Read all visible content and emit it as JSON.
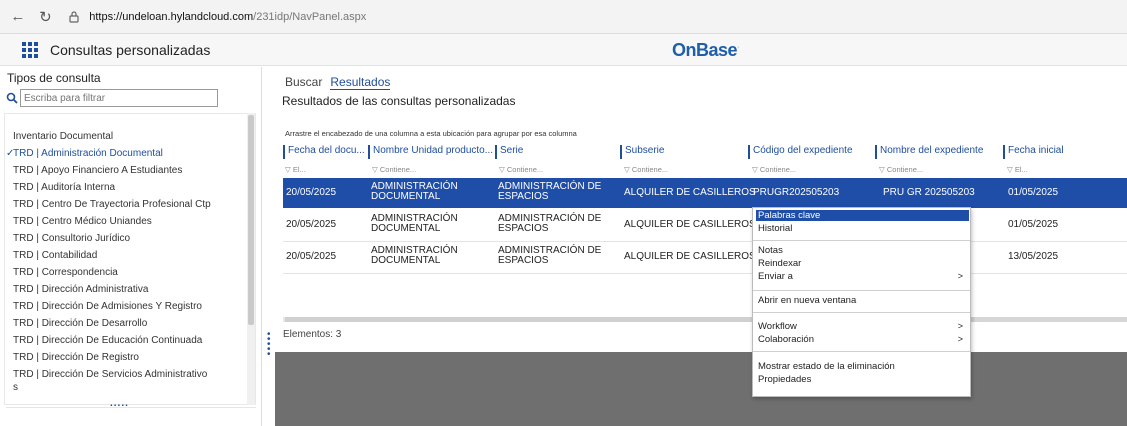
{
  "browser": {
    "url_domain": "https://undeloan.hylandcloud.com",
    "url_path": "/231idp/NavPanel.aspx"
  },
  "app": {
    "title": "Consultas personalizadas",
    "logo": "OnBase",
    "logo_mark": "·"
  },
  "left_panel": {
    "header": "Tipos de consulta",
    "filter_placeholder": "Escriba para filtrar",
    "items": [
      {
        "label": "Inventario Documental",
        "selected": false
      },
      {
        "label": "TRD | Administración Documental",
        "selected": true
      },
      {
        "label": "TRD | Apoyo Financiero A Estudiantes",
        "selected": false
      },
      {
        "label": "TRD | Auditoría Interna",
        "selected": false
      },
      {
        "label": "TRD | Centro De Trayectoria Profesional Ctp",
        "selected": false
      },
      {
        "label": "TRD | Centro Médico Uniandes",
        "selected": false
      },
      {
        "label": "TRD | Consultorio Jurídico",
        "selected": false
      },
      {
        "label": "TRD | Contabilidad",
        "selected": false
      },
      {
        "label": "TRD | Correspondencia",
        "selected": false
      },
      {
        "label": "TRD | Dirección Administrativa",
        "selected": false
      },
      {
        "label": "TRD | Dirección De Admisiones Y Registro",
        "selected": false
      },
      {
        "label": "TRD | Dirección De Desarrollo",
        "selected": false
      },
      {
        "label": "TRD | Dirección De Educación Continuada",
        "selected": false
      },
      {
        "label": "TRD | Dirección De Registro",
        "selected": false
      },
      {
        "label": "TRD | Dirección De Servicios Administrativo",
        "selected": false
      },
      {
        "label": "s",
        "selected": false
      }
    ],
    "more_dots": "....."
  },
  "main": {
    "tabs": [
      {
        "label": "Buscar",
        "active": false
      },
      {
        "label": "Resultados",
        "active": true
      }
    ],
    "results_title": "Resultados de las consultas personalizadas",
    "group_hint": "Arrastre el encabezado de una columna a esta ubicación para agrupar por esa columna",
    "columns": [
      {
        "header": "Fecha del docu...",
        "filter": "▽ El..."
      },
      {
        "header": "Nombre Unidad producto...",
        "filter": "▽ Contiene..."
      },
      {
        "header": "Serie",
        "filter": "▽ Contiene..."
      },
      {
        "header": "Subserie",
        "filter": "▽ Contiene..."
      },
      {
        "header": "Código del expediente",
        "filter": "▽ Contiene..."
      },
      {
        "header": "Nombre del expediente",
        "filter": "▽ Contiene..."
      },
      {
        "header": "Fecha inicial",
        "filter": "▽ El..."
      }
    ],
    "rows": [
      {
        "fecha": "20/05/2025",
        "unidad": [
          "ADMINISTRACIÓN",
          "DOCUMENTAL"
        ],
        "serie": [
          "ADMINISTRACIÓN DE",
          "ESPACIOS"
        ],
        "subserie": "ALQUILER DE CASILLEROS",
        "codigo": "PRUGR202505203",
        "nombre": "PRU GR 202505203",
        "fecha_inicial": "01/05/2025"
      },
      {
        "fecha": "20/05/2025",
        "unidad": [
          "ADMINISTRACIÓN",
          "DOCUMENTAL"
        ],
        "serie": [
          "ADMINISTRACIÓN DE",
          "ESPACIOS"
        ],
        "subserie": "ALQUILER DE CASILLEROS",
        "codigo": "",
        "nombre": "",
        "fecha_inicial": "01/05/2025"
      },
      {
        "fecha": "20/05/2025",
        "unidad": [
          "ADMINISTRACIÓN",
          "DOCUMENTAL"
        ],
        "serie": [
          "ADMINISTRACIÓN DE",
          "ESPACIOS"
        ],
        "subserie": "ALQUILER DE CASILLEROS",
        "codigo": "",
        "nombre": "",
        "fecha_inicial": "13/05/2025"
      }
    ],
    "count_label": "Elementos: 3"
  },
  "context_menu": {
    "items": [
      {
        "label": "Palabras clave",
        "highlight": true,
        "submenu": false
      },
      {
        "label": "Historial",
        "highlight": false,
        "submenu": false
      },
      {
        "label": "Notas",
        "highlight": false,
        "submenu": false
      },
      {
        "label": "Reindexar",
        "highlight": false,
        "submenu": false
      },
      {
        "label": "Enviar a",
        "highlight": false,
        "submenu": true
      },
      {
        "label": "Abrir en nueva ventana",
        "highlight": false,
        "submenu": false
      },
      {
        "label": "Workflow",
        "highlight": false,
        "submenu": true
      },
      {
        "label": "Colaboración",
        "highlight": false,
        "submenu": true
      },
      {
        "label": "Mostrar estado de la eliminación",
        "highlight": false,
        "submenu": false
      },
      {
        "label": "Propiedades",
        "highlight": false,
        "submenu": false
      }
    ],
    "submenu_arrow": ">"
  },
  "colors": {
    "accent": "#1f4ea8",
    "link": "#1f4e9c",
    "dark_area": "#6f6f6f"
  }
}
